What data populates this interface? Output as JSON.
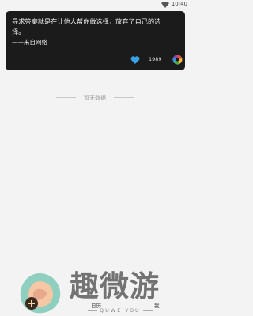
{
  "status_bar": {
    "time": "10:40"
  },
  "card": {
    "quote": "寻求答案就是在让他人帮你做选择，放弃了自己的选\n择。",
    "source": "——来自网络",
    "likes": "1989"
  },
  "empty_state": {
    "text": "暂无数据"
  },
  "brand": {
    "name": "趣微游",
    "pinyin": "QUWEIYOU"
  },
  "tabs": {
    "history": "日历",
    "me": "我"
  },
  "colors": {
    "card_bg": "#1b1b1b",
    "like_heart": "#3aa0e8",
    "page_bg": "#f3f3f3"
  }
}
